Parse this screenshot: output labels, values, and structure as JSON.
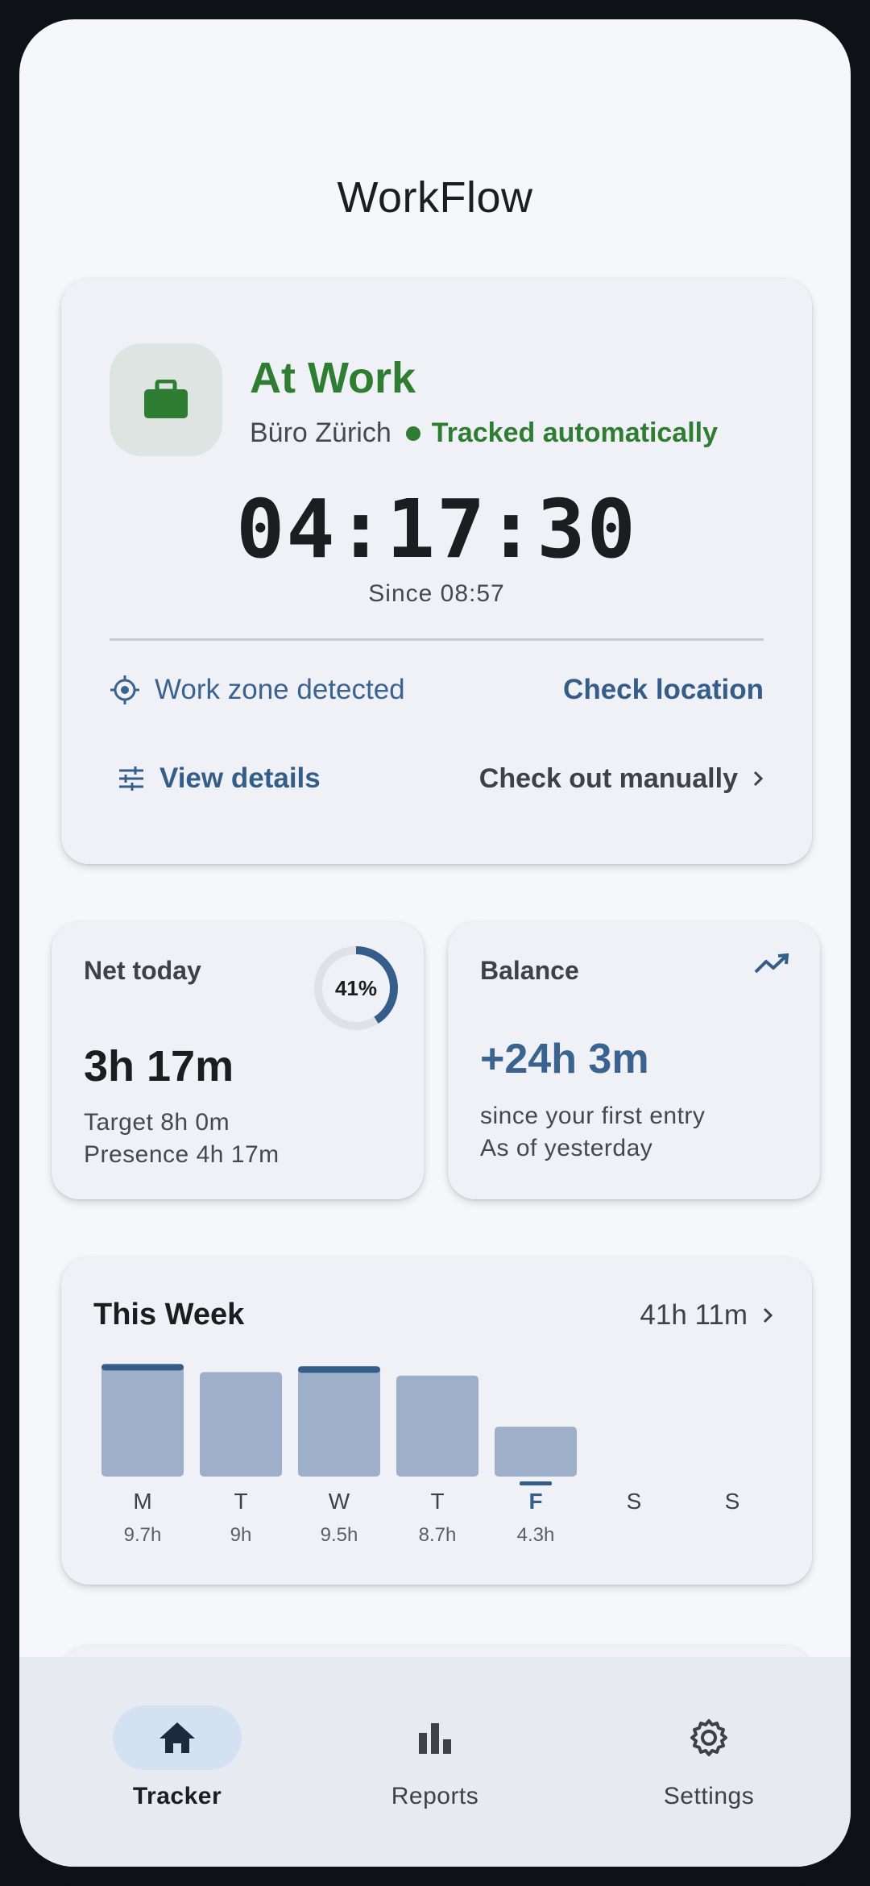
{
  "app": {
    "title": "WorkFlow"
  },
  "status": {
    "title": "At Work",
    "location": "Büro Zürich",
    "tracking": "Tracked automatically",
    "timer": "04:17:30",
    "since": "Since 08:57",
    "zone": "Work zone detected",
    "check_location": "Check location",
    "view_details": "View details",
    "check_out": "Check out manually"
  },
  "net_today": {
    "label": "Net today",
    "value": "3h 17m",
    "progress_percent": 41,
    "progress_label": "41%",
    "target": "Target 8h 0m",
    "presence": "Presence 4h 17m"
  },
  "balance": {
    "label": "Balance",
    "value": "+24h 3m",
    "note": "since your first entry",
    "as_of": "As of yesterday"
  },
  "week": {
    "title": "This Week",
    "total": "41h 11m",
    "target_hours": 9.5,
    "current_day": "F",
    "days": [
      {
        "day": "M",
        "label": "9.7h",
        "hours": 9.7
      },
      {
        "day": "T",
        "label": "9h",
        "hours": 9.0
      },
      {
        "day": "W",
        "label": "9.5h",
        "hours": 9.5
      },
      {
        "day": "T",
        "label": "8.7h",
        "hours": 8.7
      },
      {
        "day": "F",
        "label": "4.3h",
        "hours": 4.3
      },
      {
        "day": "S",
        "label": "",
        "hours": 0
      },
      {
        "day": "S",
        "label": "",
        "hours": 0
      }
    ]
  },
  "colors": {
    "accent": "#355d8a",
    "success": "#2e7d32",
    "bar": "#9eb0c9",
    "ring_track": "#dfe1e6"
  },
  "nav": {
    "items": [
      {
        "label": "Tracker",
        "icon": "home-icon",
        "active": true
      },
      {
        "label": "Reports",
        "icon": "bar-chart-icon",
        "active": false
      },
      {
        "label": "Settings",
        "icon": "gear-icon",
        "active": false
      }
    ]
  }
}
